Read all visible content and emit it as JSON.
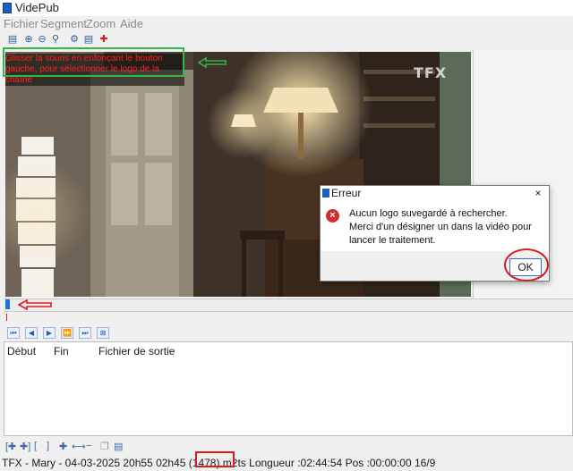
{
  "app": {
    "title": "VidePub"
  },
  "menu": [
    "Fichier",
    "Segment",
    "Zoom",
    "Aide"
  ],
  "toolbar_icons": [
    "open-icon",
    "zoom-in-icon",
    "zoom-out-icon",
    "zoom-fit-icon",
    "settings-icon",
    "export-icon",
    "add-icon"
  ],
  "video": {
    "instruction_line1": "Glisser la souris en enfonçant le bouton",
    "instruction_line2": "gauche, pour sélectionner le logo de la chaîne",
    "channel_logo": "TFX"
  },
  "dialog": {
    "title": "Erreur",
    "close": "×",
    "message_line1": "Aucun logo suvegardé à rechercher.",
    "message_line2": "Merci d'un désigner un dans la vidéo pour",
    "message_line3": "lancer le traitement.",
    "ok_label": "OK"
  },
  "segments_table": {
    "columns": [
      "Début",
      "Fin",
      "Fichier de sortie"
    ],
    "rows": []
  },
  "status": {
    "text": "TFX - Mary - 04-03-2025 20h55 02h45 (1478).m2ts Longueur :02:44:54 Pos :00:00:00 16/9"
  },
  "colors": {
    "annotation_green": "#33b54a",
    "annotation_red": "#d61f1f",
    "error_red": "#d42c2c",
    "timeline_cursor": "#1e73d8"
  }
}
